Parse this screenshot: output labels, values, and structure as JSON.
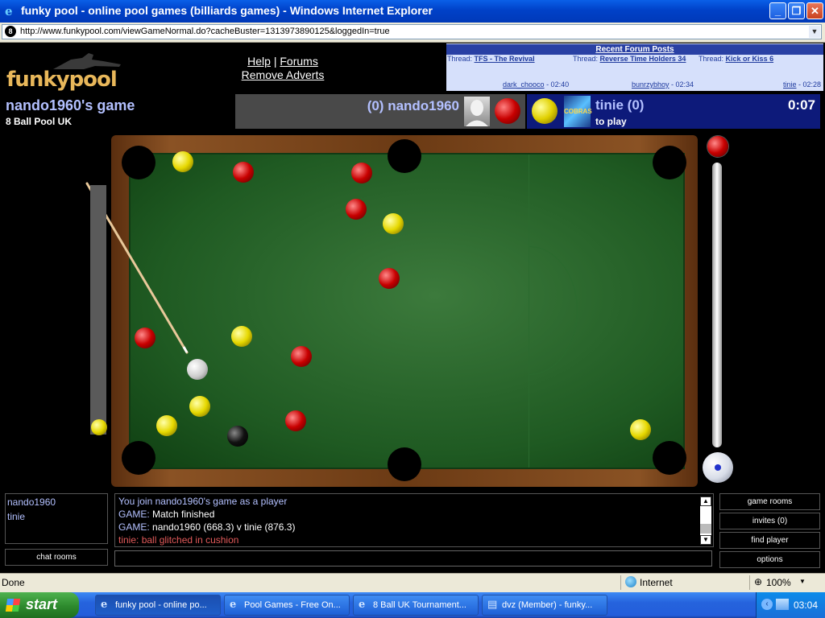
{
  "window": {
    "title": "funky pool - online pool games (billiards games) - Windows Internet Explorer",
    "address": "http://www.funkypool.com/viewGameNormal.do?cacheBuster=1313973890125&loggedIn=true"
  },
  "site": {
    "logo": "funkypool",
    "help": "Help",
    "separator": "|",
    "forums": "Forums",
    "remove_adverts": "Remove Adverts"
  },
  "forum": {
    "title": "Recent Forum Posts",
    "threads": [
      {
        "prefix": "Thread:",
        "name": "TFS - The Revival"
      },
      {
        "prefix": "Thread:",
        "name": "Reverse Time Holders 34"
      },
      {
        "prefix": "Thread:",
        "name": "Kick or Kiss 6"
      }
    ],
    "posts": [
      {
        "user": "dark_chooco",
        "time": "- 02:40"
      },
      {
        "user": "bunrzybhoy",
        "time": "- 02:34"
      },
      {
        "user": "tinie",
        "time": "- 02:28"
      }
    ]
  },
  "game": {
    "title": "nando1960's game",
    "type": "8 Ball Pool UK",
    "player1": {
      "label": "(0) nando1960",
      "ball_color": "red"
    },
    "player2": {
      "label": "tinie (0)",
      "status": "to play",
      "avatar_text": "COBRAS",
      "ball_color": "yellow"
    },
    "timer": "0:07"
  },
  "colors": {
    "accent": "#b3c0ff",
    "player2_panel": "#0d1a7a",
    "forum_bg": "#d6e0fb",
    "chat_alert": "#e25a5a"
  },
  "chat": {
    "players": [
      "nando1960",
      "tinie"
    ],
    "chat_rooms": "chat rooms",
    "lines": [
      {
        "prefix": "",
        "text": "You join nando1960's game as a player"
      },
      {
        "prefix": "GAME:",
        "text": "Match finished"
      },
      {
        "prefix": "GAME:",
        "text": "nando1960 (668.3) v tinie (876.3)"
      },
      {
        "prefix": "tinie:",
        "text": "ball glitched in cushion"
      }
    ],
    "input_value": "",
    "buttons": {
      "game_rooms": "game rooms",
      "invites": "invites (0)",
      "find_player": "find player",
      "options": "options"
    }
  },
  "status": {
    "left": "Done",
    "zone": "Internet",
    "zoom": "100%"
  },
  "taskbar": {
    "start": "start",
    "tasks": [
      {
        "label": "funky pool - online po...",
        "icon": "ie-icon"
      },
      {
        "label": "Pool Games - Free On...",
        "icon": "ie-icon"
      },
      {
        "label": "8 Ball UK Tournament...",
        "icon": "ie-icon"
      },
      {
        "label": "dvz (Member) - funky...",
        "icon": "ie-icon"
      }
    ],
    "clock": "03:04"
  }
}
